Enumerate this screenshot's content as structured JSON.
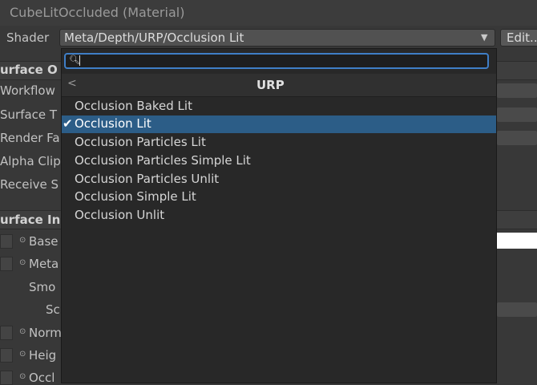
{
  "header": {
    "title": "CubeLitOccluded (Material)",
    "shader_label": "Shader",
    "shader_value": "Meta/Depth/URP/Occlusion Lit",
    "edit_label": "Edit..."
  },
  "background": {
    "surface_options": {
      "title": "urface O",
      "props": [
        "Workflow",
        "Surface T",
        "Render Fa",
        "Alpha Clip",
        "Receive S"
      ]
    },
    "surface_inputs": {
      "title": "urface In",
      "props": [
        "Base",
        "Meta",
        "Smo",
        "Sc",
        "Norm",
        "Heig",
        "Occl"
      ]
    }
  },
  "popup": {
    "search_placeholder": "",
    "title": "URP",
    "items": [
      {
        "label": "Occlusion Baked Lit",
        "selected": false
      },
      {
        "label": "Occlusion Lit",
        "selected": true
      },
      {
        "label": "Occlusion Particles Lit",
        "selected": false
      },
      {
        "label": "Occlusion Particles Simple Lit",
        "selected": false
      },
      {
        "label": "Occlusion Particles Unlit",
        "selected": false
      },
      {
        "label": "Occlusion Simple Lit",
        "selected": false
      },
      {
        "label": "Occlusion Unlit",
        "selected": false
      }
    ],
    "check_glyph": "✔"
  },
  "icons": {
    "search": "search-icon",
    "back": "chevron-left-icon",
    "dropdown": "triangle-down-icon",
    "property": "circle-dot-icon"
  },
  "colors": {
    "accent": "#3f7ec6",
    "selected_row": "#2c5d87",
    "popup_bg": "#282828",
    "inspector_bg": "#383838"
  }
}
